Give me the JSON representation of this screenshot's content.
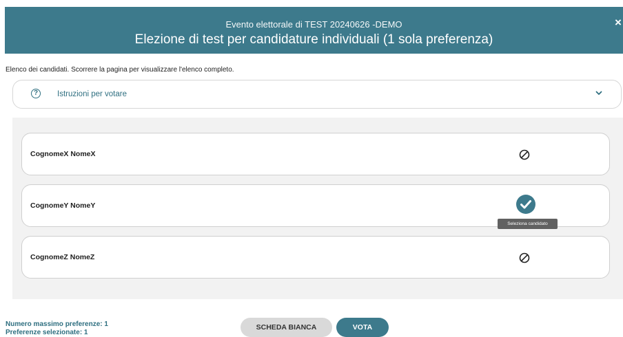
{
  "header": {
    "event": "Evento elettorale di TEST 20240626 -DEMO",
    "title": "Elezione di test per candidature individuali (1 sola preferenza)",
    "close_label": "×"
  },
  "intro": "Elenco dei candidati. Scorrere la pagina per visualizzare l'elenco completo.",
  "instructions": {
    "label": "Istruzioni per votare",
    "help_glyph": "?"
  },
  "candidates": [
    {
      "name": "CognomeX NomeX",
      "selected": false,
      "icon": "not-selected-icon"
    },
    {
      "name": "CognomeY NomeY",
      "selected": true,
      "icon": "check-circle-icon"
    },
    {
      "name": "CognomeZ NomeZ",
      "selected": false,
      "icon": "not-selected-icon"
    }
  ],
  "tooltip": "Seleziona candidato",
  "footer": {
    "max_preferences": "Numero massimo preferenze: 1",
    "selected_preferences": "Preferenze selezionate: 1",
    "blank_button": "SCHEDA BIANCA",
    "vote_button": "VOTA"
  },
  "colors": {
    "primary": "#3d7a8c",
    "panel": "#f2f2f2",
    "blank_button": "#d9d9d9"
  }
}
